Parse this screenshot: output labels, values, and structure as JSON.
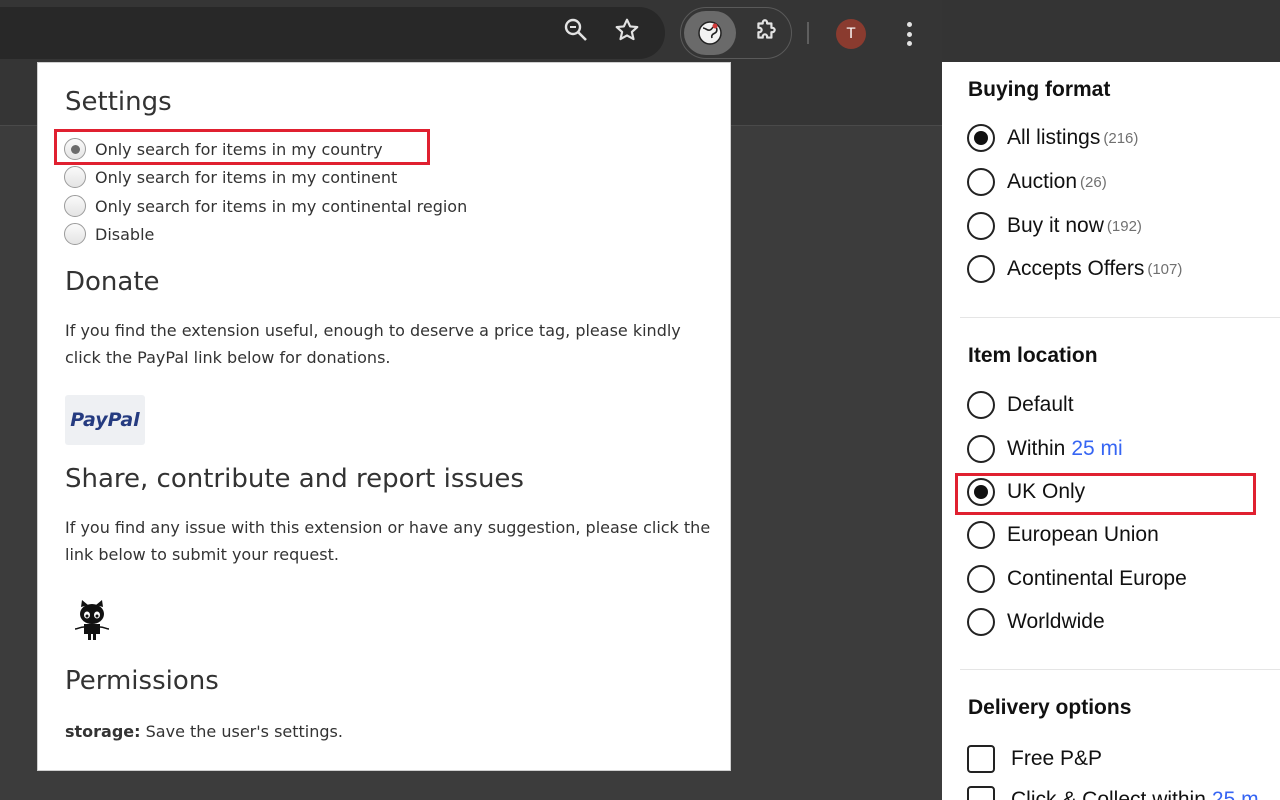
{
  "toolbar": {
    "avatar_letter": "T",
    "icons": [
      "zoom-icon",
      "bookmark-star-icon",
      "extension-globe-icon",
      "puzzle-icon",
      "more-vert-icon"
    ]
  },
  "popup": {
    "settings_title": "Settings",
    "options": [
      {
        "label": "Only search for items in my country",
        "checked": true
      },
      {
        "label": "Only search for items in my continent",
        "checked": false
      },
      {
        "label": "Only search for items in my continental region",
        "checked": false
      },
      {
        "label": "Disable",
        "checked": false
      }
    ],
    "donate_title": "Donate",
    "donate_text": "If you find the extension useful, enough to deserve a price tag, please kindly click the PayPal link below for donations.",
    "paypal_label": "PayPal",
    "share_title": "Share, contribute and report issues",
    "share_text": "If you find any issue with this extension or have any suggestion, please click the link below to submit your request.",
    "permissions_title": "Permissions",
    "permission_name": "storage:",
    "permission_desc": " Save the user's settings."
  },
  "sidebar": {
    "buying_format": {
      "title": "Buying format",
      "items": [
        {
          "label": "All listings",
          "count": "(216)",
          "checked": true
        },
        {
          "label": "Auction",
          "count": "(26)",
          "checked": false
        },
        {
          "label": "Buy it now",
          "count": "(192)",
          "checked": false
        },
        {
          "label": "Accepts Offers",
          "count": "(107)",
          "checked": false
        }
      ]
    },
    "item_location": {
      "title": "Item location",
      "items": [
        {
          "label": "Default",
          "checked": false
        },
        {
          "label": "Within",
          "link": "25 mi",
          "checked": false
        },
        {
          "label": "UK Only",
          "checked": true
        },
        {
          "label": "European Union",
          "checked": false
        },
        {
          "label": "Continental Europe",
          "checked": false
        },
        {
          "label": "Worldwide",
          "checked": false
        }
      ]
    },
    "delivery_options": {
      "title": "Delivery options",
      "items": [
        {
          "label": "Free P&P"
        },
        {
          "label": "Click & Collect within",
          "link": "25 m"
        }
      ]
    }
  },
  "colors": {
    "highlight": "#e02030",
    "link": "#3665f3",
    "paypal": "#253b80"
  }
}
